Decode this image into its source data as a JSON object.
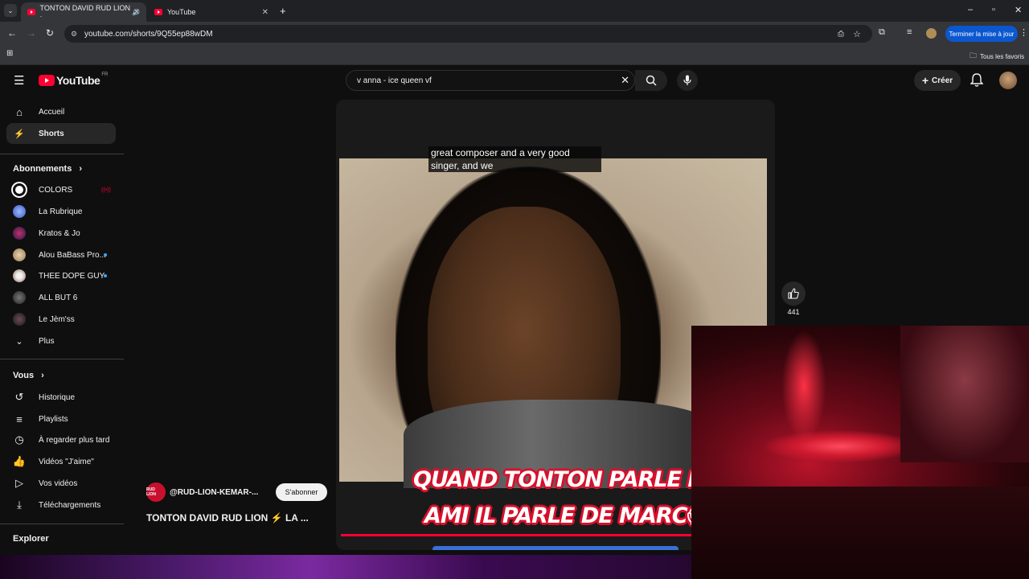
{
  "browser": {
    "tabs": [
      {
        "title": "TONTON DAVID RUD LION · ",
        "active": true
      },
      {
        "title": "YouTube",
        "active": false
      }
    ],
    "url": "youtube.com/shorts/9Q55ep88wDM",
    "update_label": "Terminer la mise à jour",
    "bookmarks_label": "Tous les favoris"
  },
  "youtube": {
    "logo_text": "YouTube",
    "logo_region": "FR",
    "search_value": "v anna - ice queen vf",
    "create_label": "Créer",
    "colors": {
      "accent": "#ff0033",
      "badge_blue": "#3ea6ff"
    }
  },
  "sidebar": {
    "main": [
      {
        "label": "Accueil",
        "icon": "home-icon"
      },
      {
        "label": "Shorts",
        "icon": "shorts-icon",
        "selected": true
      }
    ],
    "subscriptions_header": "Abonnements",
    "subscriptions": [
      {
        "label": "COLORS"
      },
      {
        "label": "La Rubrique"
      },
      {
        "label": "Kratos & Jo"
      },
      {
        "label": "Alou BaBass Pro..."
      },
      {
        "label": "THEE DOPE GUY"
      },
      {
        "label": "ALL BUT 6"
      },
      {
        "label": "Le Jèm'ss"
      },
      {
        "label": "Plus"
      }
    ],
    "you_header": "Vous",
    "you_items": [
      {
        "label": "Historique",
        "icon": "history-icon"
      },
      {
        "label": "Playlists",
        "icon": "playlists-icon"
      },
      {
        "label": "À regarder plus tard",
        "icon": "watch-later-icon"
      },
      {
        "label": "Vidéos \"J'aime\"",
        "icon": "liked-icon"
      },
      {
        "label": "Vos vidéos",
        "icon": "your-videos-icon"
      },
      {
        "label": "Téléchargements",
        "icon": "downloads-icon"
      }
    ],
    "explore_header": "Explorer"
  },
  "short": {
    "caption_line1": "great composer and a very good",
    "caption_line2": "singer, and we",
    "overlay_line1": "QUAND TONTON PARLE D'UN",
    "overlay_line2": "AMI IL PARLE DE MARC😱",
    "like_count": "441",
    "channel_avatar_text": "RUD LION",
    "channel_handle": "@RUD-LION-KEMAR-...",
    "subscribe_label": "S'abonner",
    "title": "TONTON DAVID RUD LION ⚡ LA ..."
  }
}
